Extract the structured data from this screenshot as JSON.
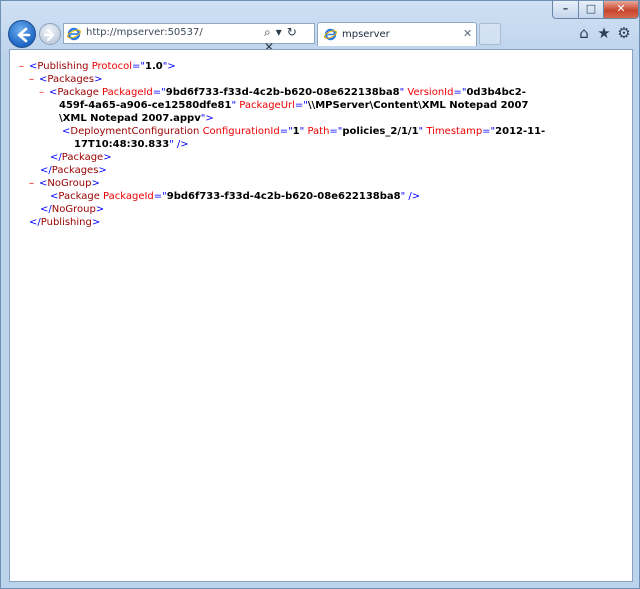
{
  "window_controls": {
    "minimize": "–",
    "maximize": "□",
    "close": "✕"
  },
  "address_bar": {
    "url": "http://mpserver:50537/",
    "search": "⌕",
    "dropdown": "▾",
    "refresh": "↻",
    "stop": "✕"
  },
  "tab": {
    "title": "mpserver",
    "close": "✕"
  },
  "toolbar_icons": {
    "home": "⌂",
    "favorites": "★",
    "tools": "⚙"
  },
  "xml": {
    "collapse": "–",
    "pub_tag": "Publishing",
    "pub_attr": "Protocol",
    "pub_val": "1.0",
    "packages_tag": "Packages",
    "package_tag": "Package",
    "packageid_attr": "PackageId",
    "packageid_val": "9bd6f733-f33d-4c2b-b620-08e622138ba8",
    "versionid_attr": "VersionId",
    "versionid_val_1": "0d3b4bc2-",
    "versionid_val_2": "459f-4a65-a906-ce12580dfe81",
    "packageurl_attr": "PackageUrl",
    "packageurl_val_1": "\\\\MPServer\\Content\\XML Notepad 2007",
    "packageurl_val_2": "\\XML Notepad 2007.appv",
    "depconf_tag": "DeploymentConfiguration",
    "configid_attr": "ConfigurationId",
    "configid_val": "1",
    "path_attr": "Path",
    "path_val": "policies_2/1/1",
    "timestamp_attr": "Timestamp",
    "timestamp_val_1": "2012-11-",
    "timestamp_val_2": "17T10:48:30.833",
    "nogroup_tag": "NoGroup",
    "nogroup_packageid_val": "9bd6f733-f33d-4c2b-b620-08e622138ba8"
  }
}
